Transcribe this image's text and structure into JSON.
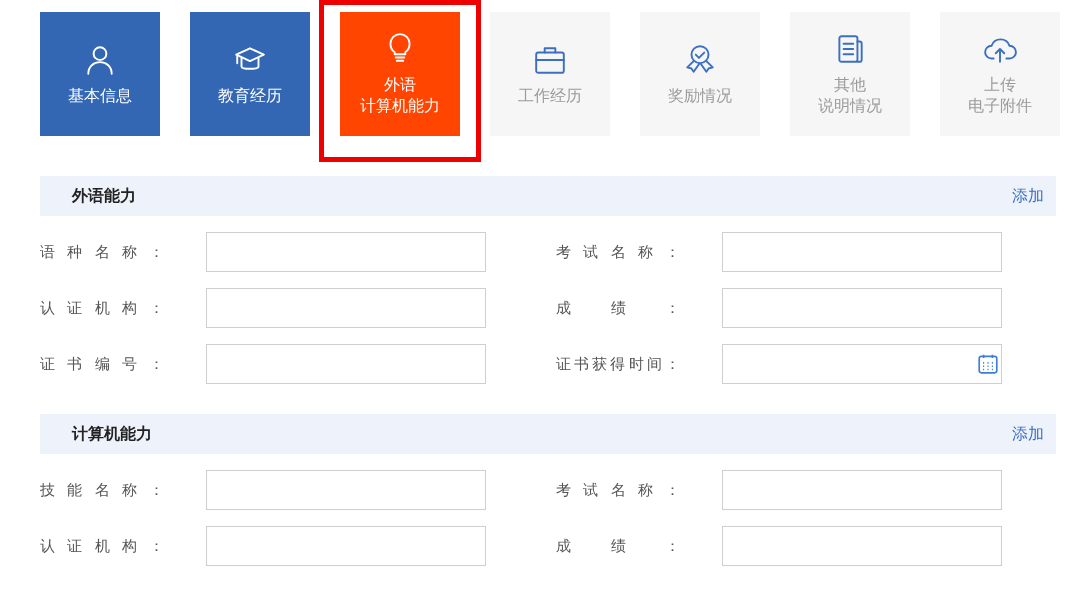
{
  "tabs": [
    {
      "label": [
        "基本信息"
      ],
      "selected": false,
      "completed": true
    },
    {
      "label": [
        "教育经历"
      ],
      "selected": false,
      "completed": true
    },
    {
      "label": [
        "外语",
        "计算机能力"
      ],
      "selected": true,
      "completed": false
    },
    {
      "label": [
        "工作经历"
      ],
      "selected": false,
      "completed": false
    },
    {
      "label": [
        "奖励情况"
      ],
      "selected": false,
      "completed": false
    },
    {
      "label": [
        "其他",
        "说明情况"
      ],
      "selected": false,
      "completed": false
    },
    {
      "label": [
        "上传",
        "电子附件"
      ],
      "selected": false,
      "completed": false
    }
  ],
  "sections": [
    {
      "title": "外语能力",
      "action": "添加",
      "fields": [
        {
          "label": "语种名称：",
          "kind": "text"
        },
        {
          "label": "考试名称：",
          "kind": "text"
        },
        {
          "label": "认证机构：",
          "kind": "text"
        },
        {
          "label": "成绩：",
          "kind": "text"
        },
        {
          "label": "证书编号：",
          "kind": "text"
        },
        {
          "label": "证书获得时间：",
          "kind": "date"
        }
      ]
    },
    {
      "title": "计算机能力",
      "action": "添加",
      "fields": [
        {
          "label": "技能名称：",
          "kind": "text"
        },
        {
          "label": "考试名称：",
          "kind": "text"
        },
        {
          "label": "认证机构：",
          "kind": "text"
        },
        {
          "label": "成绩：",
          "kind": "text"
        }
      ]
    }
  ]
}
